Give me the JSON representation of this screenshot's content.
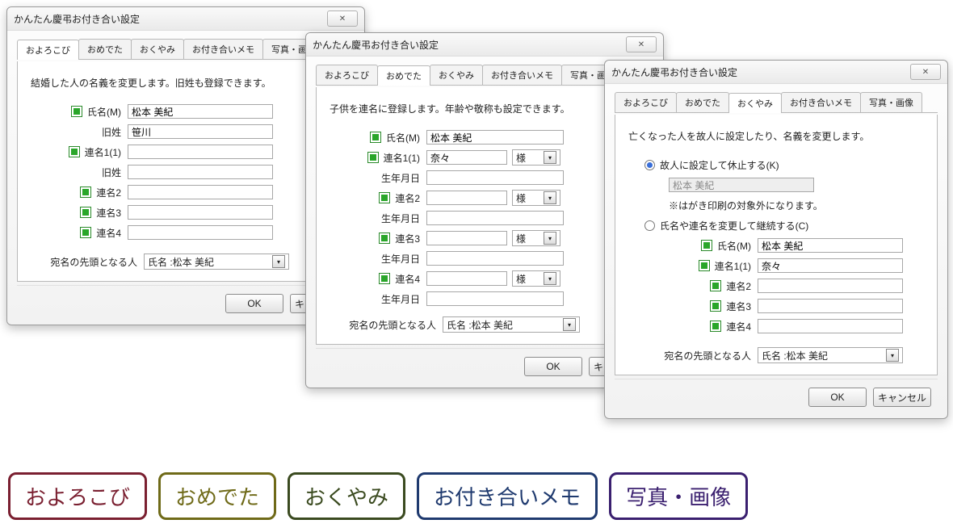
{
  "dialogTitle": "かんたん慶弔お付き合い設定",
  "tabs": [
    "およろこび",
    "おめでた",
    "おくやみ",
    "お付き合いメモ",
    "写真・画像"
  ],
  "buttons": {
    "ok": "OK",
    "cancel": "キャンセル"
  },
  "close": "✕",
  "selectArrow": "▾",
  "d1": {
    "msg": "結婚した人の名義を変更します。旧姓も登録できます。",
    "labels": {
      "name": "氏名(M)",
      "maiden": "旧姓",
      "r1": "連名1(1)",
      "r2": "連名2",
      "r3": "連名3",
      "r4": "連名4",
      "head": "宛名の先頭となる人"
    },
    "vals": {
      "name": "松本 美紀",
      "maiden": "笹川",
      "r1": "",
      "maiden2": "",
      "r2": "",
      "r3": "",
      "r4": "",
      "head": "氏名 :松本 美紀"
    }
  },
  "d2": {
    "msg": "子供を連名に登録します。年齢や敬称も設定できます。",
    "labels": {
      "name": "氏名(M)",
      "r1": "連名1(1)",
      "r2": "連名2",
      "r3": "連名3",
      "r4": "連名4",
      "dob": "生年月日",
      "title": "様",
      "head": "宛名の先頭となる人"
    },
    "vals": {
      "name": "松本 美紀",
      "r1": "奈々",
      "t1": "様",
      "r2": "",
      "t2": "様",
      "r3": "",
      "t3": "様",
      "r4": "",
      "t4": "様",
      "head": "氏名 :松本 美紀"
    }
  },
  "d3": {
    "msg": "亡くなった人を故人に設定したり、名義を変更します。",
    "opt1": "故人に設定して休止する(K)",
    "ro": "松本 美紀",
    "note": "※はがき印刷の対象外になります。",
    "opt2": "氏名や連名を変更して継続する(C)",
    "labels": {
      "name": "氏名(M)",
      "r1": "連名1(1)",
      "r2": "連名2",
      "r3": "連名3",
      "r4": "連名4",
      "head": "宛名の先頭となる人"
    },
    "vals": {
      "name": "松本 美紀",
      "r1": "奈々",
      "r2": "",
      "r3": "",
      "r4": "",
      "head": "氏名 :松本 美紀"
    }
  },
  "badges": [
    "およろこび",
    "おめでた",
    "おくやみ",
    "お付き合いメモ",
    "写真・画像"
  ]
}
